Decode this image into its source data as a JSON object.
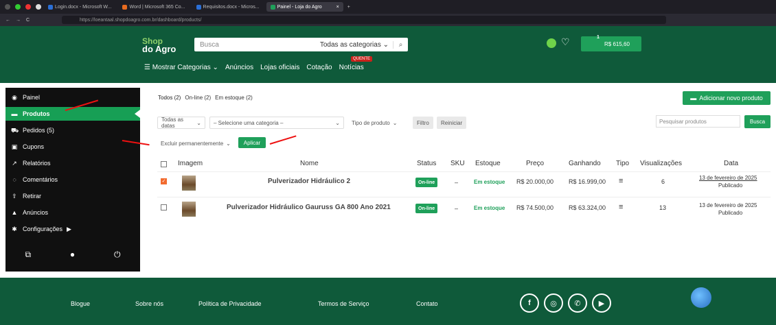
{
  "browser": {
    "tabs": [
      {
        "label": "Login.docx - Microsoft W..."
      },
      {
        "label": "Word | Microsoft 365 Co..."
      },
      {
        "label": "Requisitos.docx - Micros..."
      },
      {
        "label": "Painel - Loja do Agro"
      }
    ],
    "url": "https://loeantaal.shopdoagro.com.br/dashboard/products/"
  },
  "header": {
    "logo_line1": "Shop",
    "logo_line2": "do Agro",
    "search_placeholder": "Busca",
    "category_select": "Todas as categorias",
    "cart_amount": "R$ 615,60",
    "cart_count": "1",
    "menu": {
      "show_categories": "Mostrar Categorias",
      "ads": "Anúncios",
      "official_stores": "Lojas oficiais",
      "quote": "Cotação",
      "news": "Notícias",
      "hot_badge": "QUENTE"
    }
  },
  "sidebar": {
    "items": [
      {
        "label": "Painel",
        "icon": "dashboard-icon"
      },
      {
        "label": "Produtos",
        "icon": "briefcase-icon"
      },
      {
        "label": "Pedidos (5)",
        "icon": "cart-icon"
      },
      {
        "label": "Cupons",
        "icon": "gift-icon"
      },
      {
        "label": "Relatórios",
        "icon": "chart-icon"
      },
      {
        "label": "Comentários",
        "icon": "comments-icon"
      },
      {
        "label": "Retirar",
        "icon": "upload-icon"
      },
      {
        "label": "Anúncios",
        "icon": "bell-icon"
      },
      {
        "label": "Configurações",
        "icon": "gear-icon"
      }
    ]
  },
  "main": {
    "filter_links": [
      "Todos (2)",
      "On-line (2)",
      "Em estoque (2)"
    ],
    "add_product": "Adicionar novo produto",
    "dates_select": "Todas as datas",
    "category_select": "– Selecione uma categoria –",
    "type_select": "Tipo de produto",
    "filter_btn": "Filtro",
    "reset_btn": "Reiniciar",
    "search_placeholder": "Pesquisar produtos",
    "search_btn": "Busca",
    "bulk_select": "Excluir permanentemente",
    "apply_btn": "Aplicar",
    "columns": [
      "Imagem",
      "Nome",
      "Status",
      "SKU",
      "Estoque",
      "Preço",
      "Ganhando",
      "Tipo",
      "Visualizações",
      "Data"
    ],
    "rows": [
      {
        "name": "Pulverizador Hidráulico 2",
        "status": "On-line",
        "sku": "–",
        "stock": "Em estoque",
        "price": "R$ 20.000,00",
        "earning": "R$ 16.999,00",
        "type": "≡",
        "views": "6",
        "date": "13 de fevereiro de 2025",
        "published": "Publicado",
        "checked": true
      },
      {
        "name": "Pulverizador Hidráulico Gauruss GA 800 Ano 2021",
        "status": "On-line",
        "sku": "–",
        "stock": "Em estoque",
        "price": "R$ 74.500,00",
        "earning": "R$ 63.324,00",
        "type": "≡",
        "views": "13",
        "date": "13 de fevereiro de 2025",
        "published": "Publicado",
        "checked": false
      }
    ]
  },
  "footer": {
    "links": [
      "Blogue",
      "Sobre nós",
      "Política de Privacidade",
      "Termos de Serviço",
      "Contato"
    ],
    "social": [
      "facebook-icon",
      "instagram-icon",
      "whatsapp-icon",
      "youtube-icon"
    ]
  },
  "colors": {
    "brand_dark": "#0f5a3a",
    "accent": "#1fa05a",
    "sidebar": "#101010"
  }
}
